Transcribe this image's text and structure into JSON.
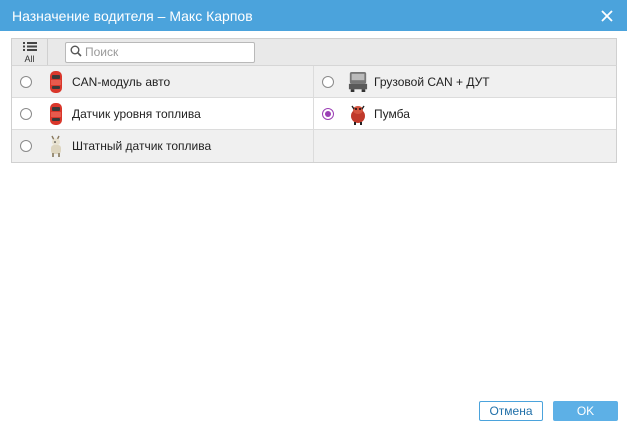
{
  "dialog": {
    "title": "Назначение водителя – Макс Карпов",
    "close_icon": "close-icon"
  },
  "toolbar": {
    "all_label": "All",
    "search_placeholder": "Поиск",
    "search_value": ""
  },
  "units": [
    {
      "label": "CAN-модуль авто",
      "icon": "red-car-icon",
      "selected": false
    },
    {
      "label": "Грузовой CAN + ДУТ",
      "icon": "truck-icon",
      "selected": false
    },
    {
      "label": "Датчик уровня топлива",
      "icon": "red-car-icon",
      "selected": false
    },
    {
      "label": "Пумба",
      "icon": "warthog-icon",
      "selected": true
    },
    {
      "label": "Штатный датчик топлива",
      "icon": "goat-icon",
      "selected": false
    }
  ],
  "footer": {
    "cancel_label": "Отмена",
    "ok_label": "OK"
  },
  "colors": {
    "titlebar": "#4ba3dc",
    "accent_radio": "#9b3fb5",
    "ok_button": "#5db0e6"
  }
}
